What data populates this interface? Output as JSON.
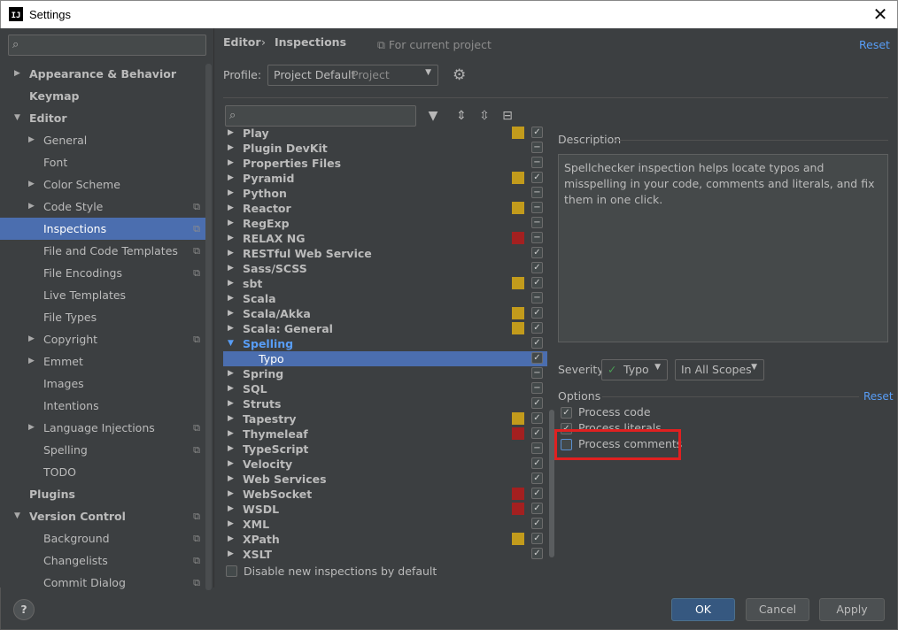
{
  "window": {
    "title": "Settings",
    "app_icon": "IJ"
  },
  "sidebar": {
    "search_placeholder": "",
    "items": [
      {
        "label": "Appearance & Behavior",
        "bold": true,
        "arrow": "▶",
        "level": 0
      },
      {
        "label": "Keymap",
        "bold": true,
        "arrow": "",
        "level": 0
      },
      {
        "label": "Editor",
        "bold": true,
        "arrow": "▼",
        "level": 0
      },
      {
        "label": "General",
        "arrow": "▶",
        "level": 1
      },
      {
        "label": "Font",
        "arrow": "",
        "level": 1
      },
      {
        "label": "Color Scheme",
        "arrow": "▶",
        "level": 1
      },
      {
        "label": "Code Style",
        "arrow": "▶",
        "level": 1,
        "copy": true
      },
      {
        "label": "Inspections",
        "arrow": "",
        "level": 1,
        "copy": true,
        "selected": true
      },
      {
        "label": "File and Code Templates",
        "arrow": "",
        "level": 1,
        "copy": true
      },
      {
        "label": "File Encodings",
        "arrow": "",
        "level": 1,
        "copy": true
      },
      {
        "label": "Live Templates",
        "arrow": "",
        "level": 1
      },
      {
        "label": "File Types",
        "arrow": "",
        "level": 1
      },
      {
        "label": "Copyright",
        "arrow": "▶",
        "level": 1,
        "copy": true
      },
      {
        "label": "Emmet",
        "arrow": "▶",
        "level": 1
      },
      {
        "label": "Images",
        "arrow": "",
        "level": 1
      },
      {
        "label": "Intentions",
        "arrow": "",
        "level": 1
      },
      {
        "label": "Language Injections",
        "arrow": "▶",
        "level": 1,
        "copy": true
      },
      {
        "label": "Spelling",
        "arrow": "",
        "level": 1,
        "copy": true
      },
      {
        "label": "TODO",
        "arrow": "",
        "level": 1
      },
      {
        "label": "Plugins",
        "bold": true,
        "arrow": "",
        "level": 0
      },
      {
        "label": "Version Control",
        "bold": true,
        "arrow": "▼",
        "level": 0,
        "copy": true
      },
      {
        "label": "Background",
        "arrow": "",
        "level": 1,
        "copy": true
      },
      {
        "label": "Changelists",
        "arrow": "",
        "level": 1,
        "copy": true
      },
      {
        "label": "Commit Dialog",
        "arrow": "",
        "level": 1,
        "copy": true
      }
    ]
  },
  "header": {
    "crumb_1": "Editor",
    "crumb_sep": "›",
    "crumb_2": "Inspections",
    "for_project": "For current project",
    "reset": "Reset"
  },
  "profile": {
    "label": "Profile:",
    "value": "Project Default",
    "scope": "Project"
  },
  "inspections": [
    {
      "label": "Play",
      "sev": "#c29b1c",
      "check": "✓"
    },
    {
      "label": "Plugin DevKit",
      "sev": "",
      "check": "−"
    },
    {
      "label": "Properties Files",
      "sev": "",
      "check": "−"
    },
    {
      "label": "Pyramid",
      "sev": "#c29b1c",
      "check": "✓"
    },
    {
      "label": "Python",
      "sev": "",
      "check": "−"
    },
    {
      "label": "Reactor",
      "sev": "#c29b1c",
      "check": "−"
    },
    {
      "label": "RegExp",
      "sev": "",
      "check": "−"
    },
    {
      "label": "RELAX NG",
      "sev": "#a32020",
      "check": "−"
    },
    {
      "label": "RESTful Web Service",
      "sev": "",
      "check": "✓"
    },
    {
      "label": "Sass/SCSS",
      "sev": "",
      "check": "✓"
    },
    {
      "label": "sbt",
      "sev": "#c29b1c",
      "check": "✓"
    },
    {
      "label": "Scala",
      "sev": "",
      "check": "−"
    },
    {
      "label": "Scala/Akka",
      "sev": "#c29b1c",
      "check": "✓"
    },
    {
      "label": "Scala: General",
      "sev": "#c29b1c",
      "check": "✓"
    },
    {
      "label": "Spelling",
      "sev": "",
      "check": "✓",
      "expanded": true
    },
    {
      "label": "Typo",
      "sev": "",
      "check": "✓",
      "child": true,
      "selected": true
    },
    {
      "label": "Spring",
      "sev": "",
      "check": "−"
    },
    {
      "label": "SQL",
      "sev": "",
      "check": "−"
    },
    {
      "label": "Struts",
      "sev": "",
      "check": "✓"
    },
    {
      "label": "Tapestry",
      "sev": "#c29b1c",
      "check": "✓"
    },
    {
      "label": "Thymeleaf",
      "sev": "#a32020",
      "check": "✓"
    },
    {
      "label": "TypeScript",
      "sev": "",
      "check": "−"
    },
    {
      "label": "Velocity",
      "sev": "",
      "check": "✓"
    },
    {
      "label": "Web Services",
      "sev": "",
      "check": "✓"
    },
    {
      "label": "WebSocket",
      "sev": "#a32020",
      "check": "✓"
    },
    {
      "label": "WSDL",
      "sev": "#a32020",
      "check": "✓"
    },
    {
      "label": "XML",
      "sev": "",
      "check": "✓"
    },
    {
      "label": "XPath",
      "sev": "#c29b1c",
      "check": "✓"
    },
    {
      "label": "XSLT",
      "sev": "",
      "check": "✓"
    }
  ],
  "bottom_checkbox": "Disable new inspections by default",
  "description": {
    "title": "Description",
    "text": "Spellchecker inspection helps locate typos and misspelling in your code, comments and literals, and fix them in one click."
  },
  "severity": {
    "label": "Severity:",
    "value": "Typo",
    "scope": "In All Scopes"
  },
  "options": {
    "title": "Options",
    "reset": "Reset",
    "items": [
      {
        "label": "Process code",
        "checked": true
      },
      {
        "label": "Process literals",
        "checked": true
      },
      {
        "label": "Process comments",
        "checked": false
      }
    ]
  },
  "footer": {
    "help": "?",
    "ok": "OK",
    "cancel": "Cancel",
    "apply": "Apply"
  }
}
